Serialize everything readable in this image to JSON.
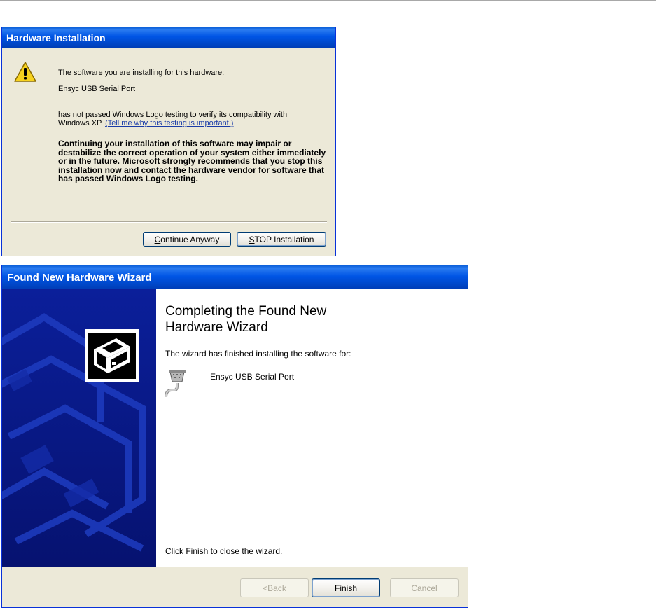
{
  "hardware_installation": {
    "title": "Hardware Installation",
    "line1": "The software you are installing for this hardware:",
    "device": "Ensyc USB Serial Port",
    "logo_text": "has not passed Windows Logo testing to verify its compatibility with Windows XP. ",
    "link": "(Tell me why this testing is important.)",
    "warning": "Continuing your installation of this software may impair or destabilize the correct operation of your system either immediately or in the future. Microsoft strongly recommends that you stop this installation now and contact the hardware vendor for software that has passed Windows Logo testing.",
    "continue_button": {
      "accel": "C",
      "rest": "ontinue Anyway"
    },
    "stop_button": {
      "accel": "S",
      "rest": "TOP Installation"
    }
  },
  "wizard": {
    "title": "Found New Hardware Wizard",
    "heading_line1": "Completing the Found New",
    "heading_line2": "Hardware Wizard",
    "subtext": "The wizard has finished installing the software for:",
    "device": "Ensyc USB Serial Port",
    "finish_hint": "Click Finish to close the wizard.",
    "back_button": {
      "prefix": "< ",
      "accel": "B",
      "rest": "ack"
    },
    "finish_button": "Finish",
    "cancel_button": "Cancel"
  },
  "colors": {
    "titlebar": "#0055e5",
    "dialog_face": "#ece9d8",
    "wizard_sidebar": "#0a1a8a",
    "link": "#1a3ca8"
  },
  "icons": [
    "warning-icon",
    "hardware-box-icon",
    "serial-port-icon"
  ]
}
